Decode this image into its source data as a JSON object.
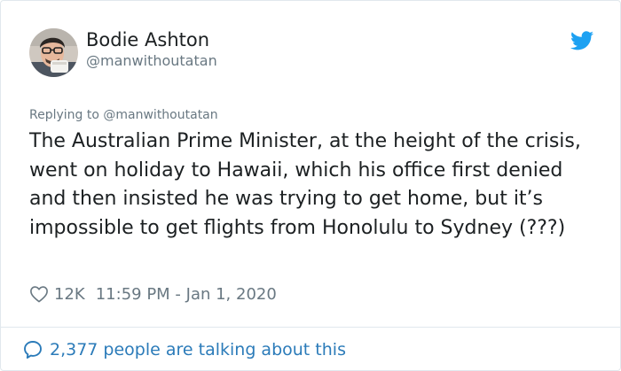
{
  "author": {
    "display_name": "Bodie Ashton",
    "handle": "@manwithoutatan"
  },
  "reply": {
    "prefix": "Replying to ",
    "handle": "@manwithoutatan"
  },
  "tweet": {
    "text": "The Australian Prime Minister, at the height of the crisis, went on holiday to Hawaii, which his office first denied and then insisted he was trying to get home, but it’s impossible to get flights from Honolulu to Sydney (???)"
  },
  "meta": {
    "likes": "12K",
    "timestamp": "11:59 PM - Jan 1, 2020"
  },
  "footer": {
    "talking": "2,377 people are talking about this"
  },
  "icons": {
    "brand": "twitter-bird-icon",
    "like": "heart-icon",
    "conversation": "speech-bubble-icon"
  },
  "colors": {
    "brand_blue": "#1da1f2",
    "link_blue": "#2b7bb9",
    "text": "#1c2022",
    "muted": "#697882",
    "border": "#e1e8ed"
  }
}
